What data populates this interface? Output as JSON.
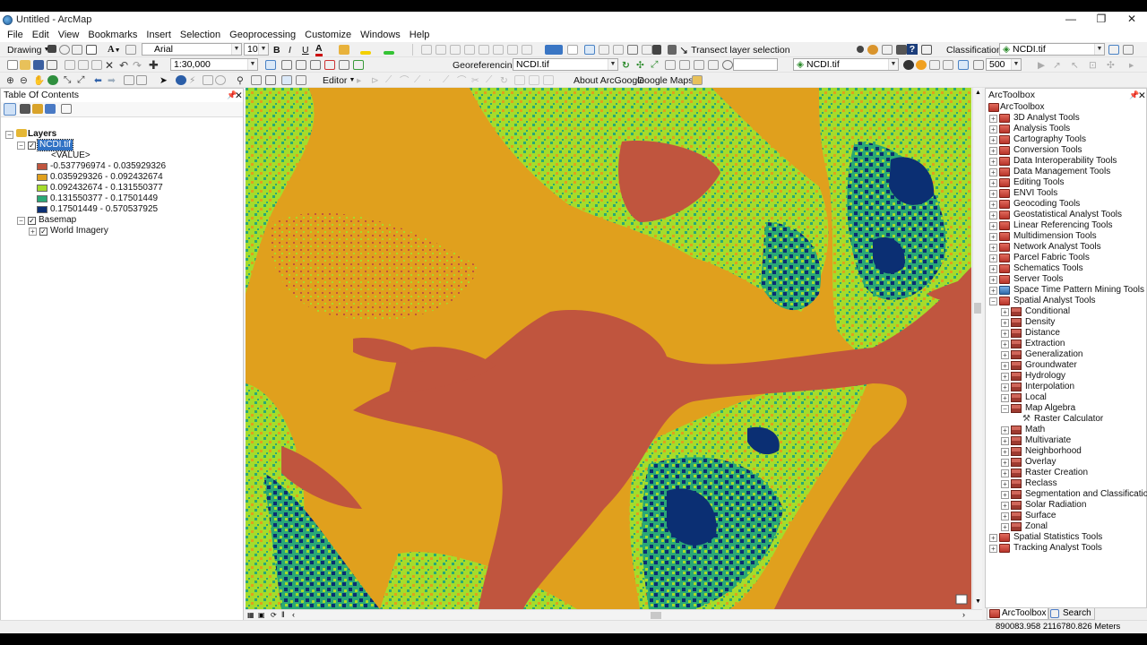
{
  "window": {
    "title": "Untitled - ArcMap",
    "controls": [
      "—",
      "❐",
      "✕"
    ]
  },
  "menu": [
    "File",
    "Edit",
    "View",
    "Bookmarks",
    "Insert",
    "Selection",
    "Geoprocessing",
    "Customize",
    "Windows",
    "Help"
  ],
  "toolbar1": {
    "drawing_label": "Drawing",
    "font_name": "Arial",
    "font_size": "10",
    "bold": "B",
    "italic": "I",
    "underline": "U",
    "transect_label": "Transect layer selection",
    "classification_label": "Classification",
    "classification_layer": "NCDI.tif"
  },
  "toolbar2": {
    "scale": "1:30,000",
    "georeferencing_label": "Georeferencing",
    "georef_layer": "NCDI.tif",
    "image_layer": "NCDI.tif",
    "zoom_value": "500"
  },
  "toolbar3": {
    "editor_label": "Editor",
    "about_label": "About ArcGoogle",
    "googlemaps_label": "Google Maps"
  },
  "toc": {
    "title": "Table Of Contents",
    "layers_label": "Layers",
    "layer_name": "NCDI.tif",
    "value_label": "<VALUE>",
    "legend": [
      {
        "range": "-0.537796974 - 0.035929326",
        "color": "#c0553e"
      },
      {
        "range": "0.035929326 - 0.092432674",
        "color": "#e0a01d"
      },
      {
        "range": "0.092432674 - 0.131550377",
        "color": "#a5dc2b"
      },
      {
        "range": "0.131550377 - 0.17501449",
        "color": "#2aa876"
      },
      {
        "range": "0.17501449 - 0.570537925",
        "color": "#0b2f73"
      }
    ],
    "basemap_label": "Basemap",
    "basemap_child": "World Imagery"
  },
  "arctoolbox": {
    "title": "ArcToolbox",
    "root": "ArcToolbox",
    "toolboxes": [
      "3D Analyst Tools",
      "Analysis Tools",
      "Cartography Tools",
      "Conversion Tools",
      "Data Interoperability Tools",
      "Data Management Tools",
      "Editing Tools",
      "ENVI Tools",
      "Geocoding Tools",
      "Geostatistical Analyst Tools",
      "Linear Referencing Tools",
      "Multidimension Tools",
      "Network Analyst Tools",
      "Parcel Fabric Tools",
      "Schematics Tools",
      "Server Tools",
      "Space Time Pattern Mining Tools",
      "Spatial Analyst Tools"
    ],
    "spatial_children": [
      "Conditional",
      "Density",
      "Distance",
      "Extraction",
      "Generalization",
      "Groundwater",
      "Hydrology",
      "Interpolation",
      "Local",
      "Map Algebra"
    ],
    "map_algebra_tool": "Raster Calculator",
    "spatial_children2": [
      "Math",
      "Multivariate",
      "Neighborhood",
      "Overlay",
      "Raster Creation",
      "Reclass",
      "Segmentation and Classification",
      "Solar Radiation",
      "Surface",
      "Zonal"
    ],
    "after": [
      "Spatial Statistics Tools",
      "Tracking Analyst Tools"
    ],
    "tabs": [
      "ArcToolbox",
      "Search"
    ]
  },
  "status": {
    "coords": "890083.958  2116780.826 Meters"
  },
  "colors": {
    "red": "#c0553e",
    "orange": "#e0a01d",
    "lime": "#a5dc2b",
    "teal": "#2aa876",
    "navy": "#0b2f73"
  }
}
